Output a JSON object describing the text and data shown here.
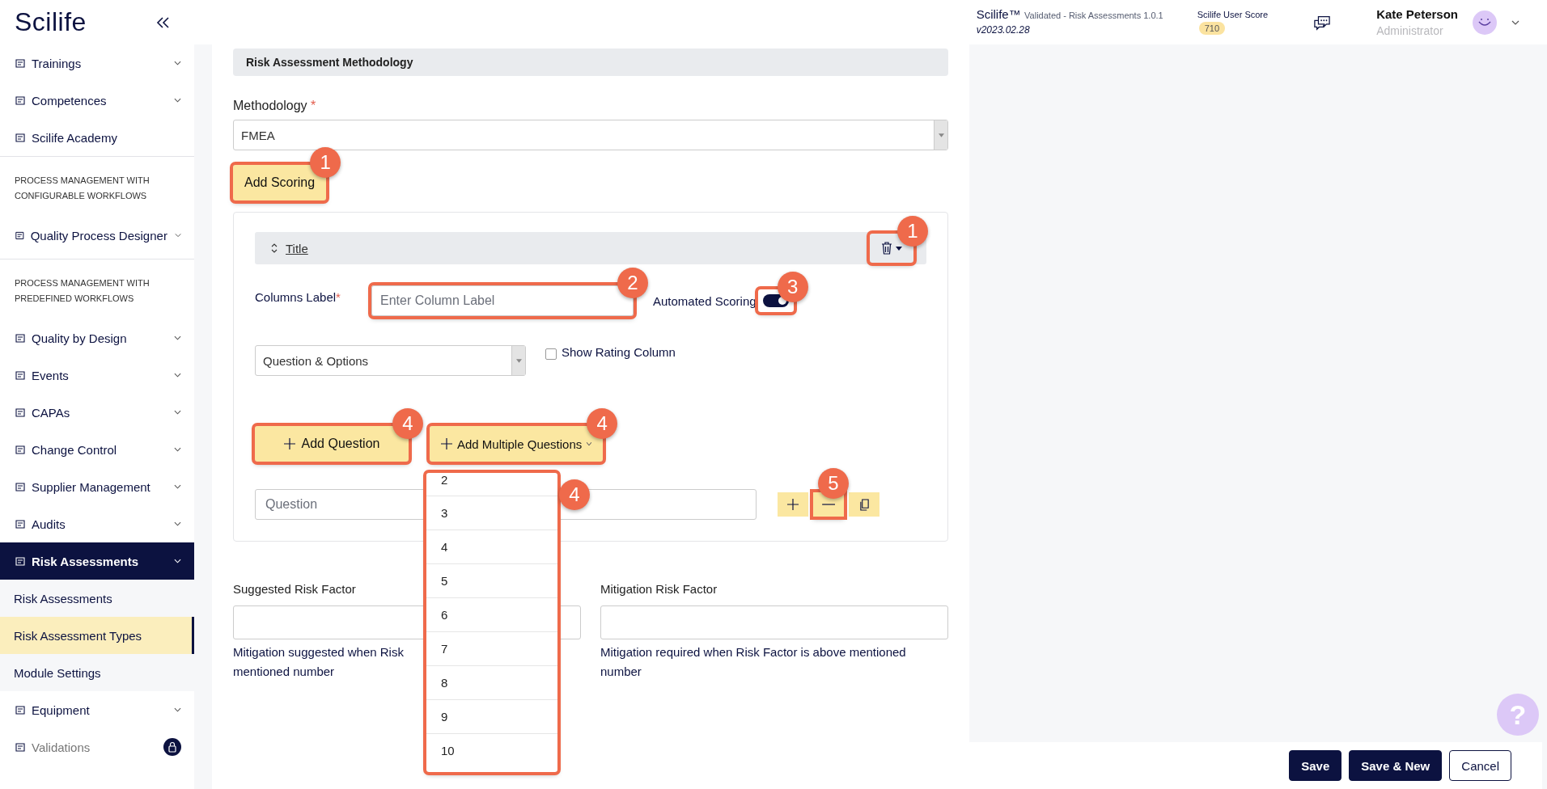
{
  "header": {
    "logo": "Scilife",
    "app_name": "Scilife™",
    "app_detail": "Validated - Risk Assessments 1.0.1",
    "version": "v2023.02.28",
    "score_label": "Scilife User Score",
    "score": "710",
    "user_name": "Kate Peterson",
    "user_role": "Administrator"
  },
  "sidebar": {
    "items": [
      {
        "kind": "nav",
        "label": "Trainings",
        "selected": false
      },
      {
        "kind": "nav",
        "label": "Competences",
        "selected": false
      },
      {
        "kind": "link",
        "label": "Scilife Academy",
        "selected": false
      },
      {
        "kind": "heading",
        "label": "PROCESS MANAGEMENT WITH CONFIGURABLE WORKFLOWS"
      },
      {
        "kind": "nav",
        "label": "Quality Process Designer",
        "selected": false
      },
      {
        "kind": "heading",
        "label": "PROCESS MANAGEMENT WITH PREDEFINED WORKFLOWS"
      },
      {
        "kind": "nav",
        "label": "Quality by Design",
        "selected": false
      },
      {
        "kind": "nav",
        "label": "Events",
        "selected": false
      },
      {
        "kind": "nav",
        "label": "CAPAs",
        "selected": false
      },
      {
        "kind": "nav",
        "label": "Change Control",
        "selected": false
      },
      {
        "kind": "nav",
        "label": "Supplier Management",
        "selected": false
      },
      {
        "kind": "nav",
        "label": "Audits",
        "selected": false
      },
      {
        "kind": "nav",
        "label": "Risk Assessments",
        "selected": true
      },
      {
        "kind": "sub",
        "label": "Risk Assessments",
        "selected": false
      },
      {
        "kind": "sub",
        "label": "Risk Assessment Types",
        "selected": true
      },
      {
        "kind": "sub",
        "label": "Module Settings",
        "selected": false
      },
      {
        "kind": "nav",
        "label": "Equipment",
        "selected": false
      },
      {
        "kind": "locked",
        "label": "Validations",
        "selected": false
      }
    ]
  },
  "form": {
    "section_title": "Risk Assessment Methodology",
    "methodology": {
      "label": "Methodology",
      "required_mark": "*",
      "value": "FMEA"
    },
    "add_scoring": {
      "label": "Add Scoring",
      "callout": "1"
    },
    "scoring_card": {
      "title": "Title",
      "delete_callout": "1",
      "columns_label": {
        "label": "Columns Label",
        "required_mark": "*",
        "placeholder": "Enter Column Label",
        "callout": "2"
      },
      "automated_scoring": {
        "label": "Automated Scoring",
        "on": true,
        "callout": "3"
      },
      "type_select": {
        "value": "Question & Options"
      },
      "show_rating": {
        "label": "Show Rating Column",
        "checked": false
      },
      "add_question": {
        "label": "Add Question",
        "callout": "4"
      },
      "add_multiple": {
        "label": "Add Multiple Questions",
        "callout": "4"
      },
      "question": {
        "placeholder": "Question"
      },
      "remove_callout": "5"
    },
    "count_menu": {
      "callout": "4",
      "options": [
        "2",
        "3",
        "4",
        "5",
        "6",
        "7",
        "8",
        "9",
        "10"
      ]
    },
    "factors": [
      {
        "label": "Suggested Risk Factor",
        "help_lines": [
          "Mitigation suggested when Risk",
          "mentioned number"
        ]
      },
      {
        "label": "Mitigation Risk Factor",
        "help_lines": [
          "Mitigation required when Risk Factor is above mentioned number"
        ]
      }
    ]
  },
  "footer": {
    "help_label": "?",
    "buttons": [
      {
        "label": "Save",
        "kind": "primary"
      },
      {
        "label": "Save & New",
        "kind": "primary"
      },
      {
        "label": "Cancel",
        "kind": "secondary"
      }
    ]
  }
}
